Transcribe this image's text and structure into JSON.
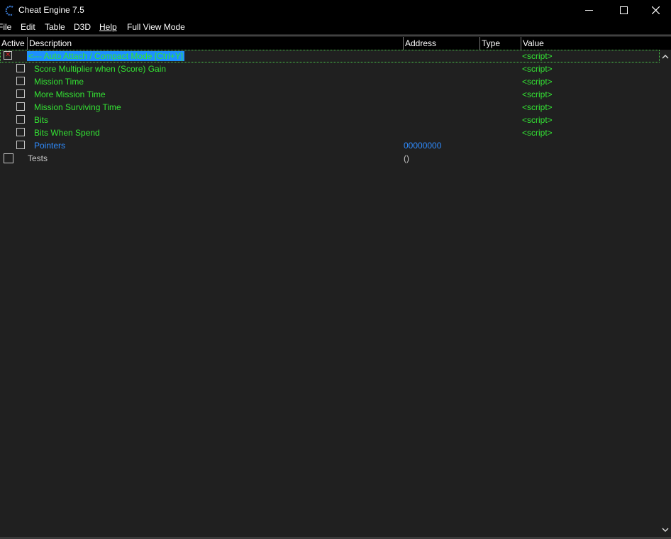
{
  "window": {
    "title": "Cheat Engine 7.5",
    "app_icon": "cheat-engine-logo-icon",
    "controls": [
      "minimize-icon",
      "maximize-icon",
      "close-icon"
    ]
  },
  "menu": {
    "file": "File",
    "edit": "Edit",
    "table": "Table",
    "d3d": "D3D",
    "help": "Help",
    "full_view": "Full View Mode"
  },
  "columns": {
    "active": "Active",
    "description": "Description",
    "address": "Address",
    "type": "Type",
    "value": "Value"
  },
  "rows": [
    {
      "description": "<--- Auto Attach / Compact Mode [Ctrl+Y]",
      "address": "",
      "type": "",
      "value": "<script>",
      "checked": true,
      "selected": true
    },
    {
      "description": "Score Multiplier when (Score) Gain",
      "address": "",
      "type": "",
      "value": "<script>",
      "checked": false
    },
    {
      "description": "Mission Time",
      "address": "",
      "type": "",
      "value": "<script>",
      "checked": false
    },
    {
      "description": "More Mission Time",
      "address": "",
      "type": "",
      "value": "<script>",
      "checked": false
    },
    {
      "description": "Mission Surviving Time",
      "address": "",
      "type": "",
      "value": "<script>",
      "checked": false
    },
    {
      "description": "Bits",
      "address": "",
      "type": "",
      "value": "<script>",
      "checked": false
    },
    {
      "description": "Bits When Spend",
      "address": "",
      "type": "",
      "value": "<script>",
      "checked": false
    },
    {
      "description": "Pointers",
      "address": "00000000",
      "type": "",
      "value": "",
      "checked": false
    },
    {
      "description": "Tests",
      "address": "()",
      "type": "",
      "value": "",
      "checked": false
    }
  ],
  "colors": {
    "script_green": "#33e233",
    "pointer_blue": "#2f8cff",
    "selection_blue": "#1e90ff",
    "checkbox_x_red": "#d32020"
  }
}
